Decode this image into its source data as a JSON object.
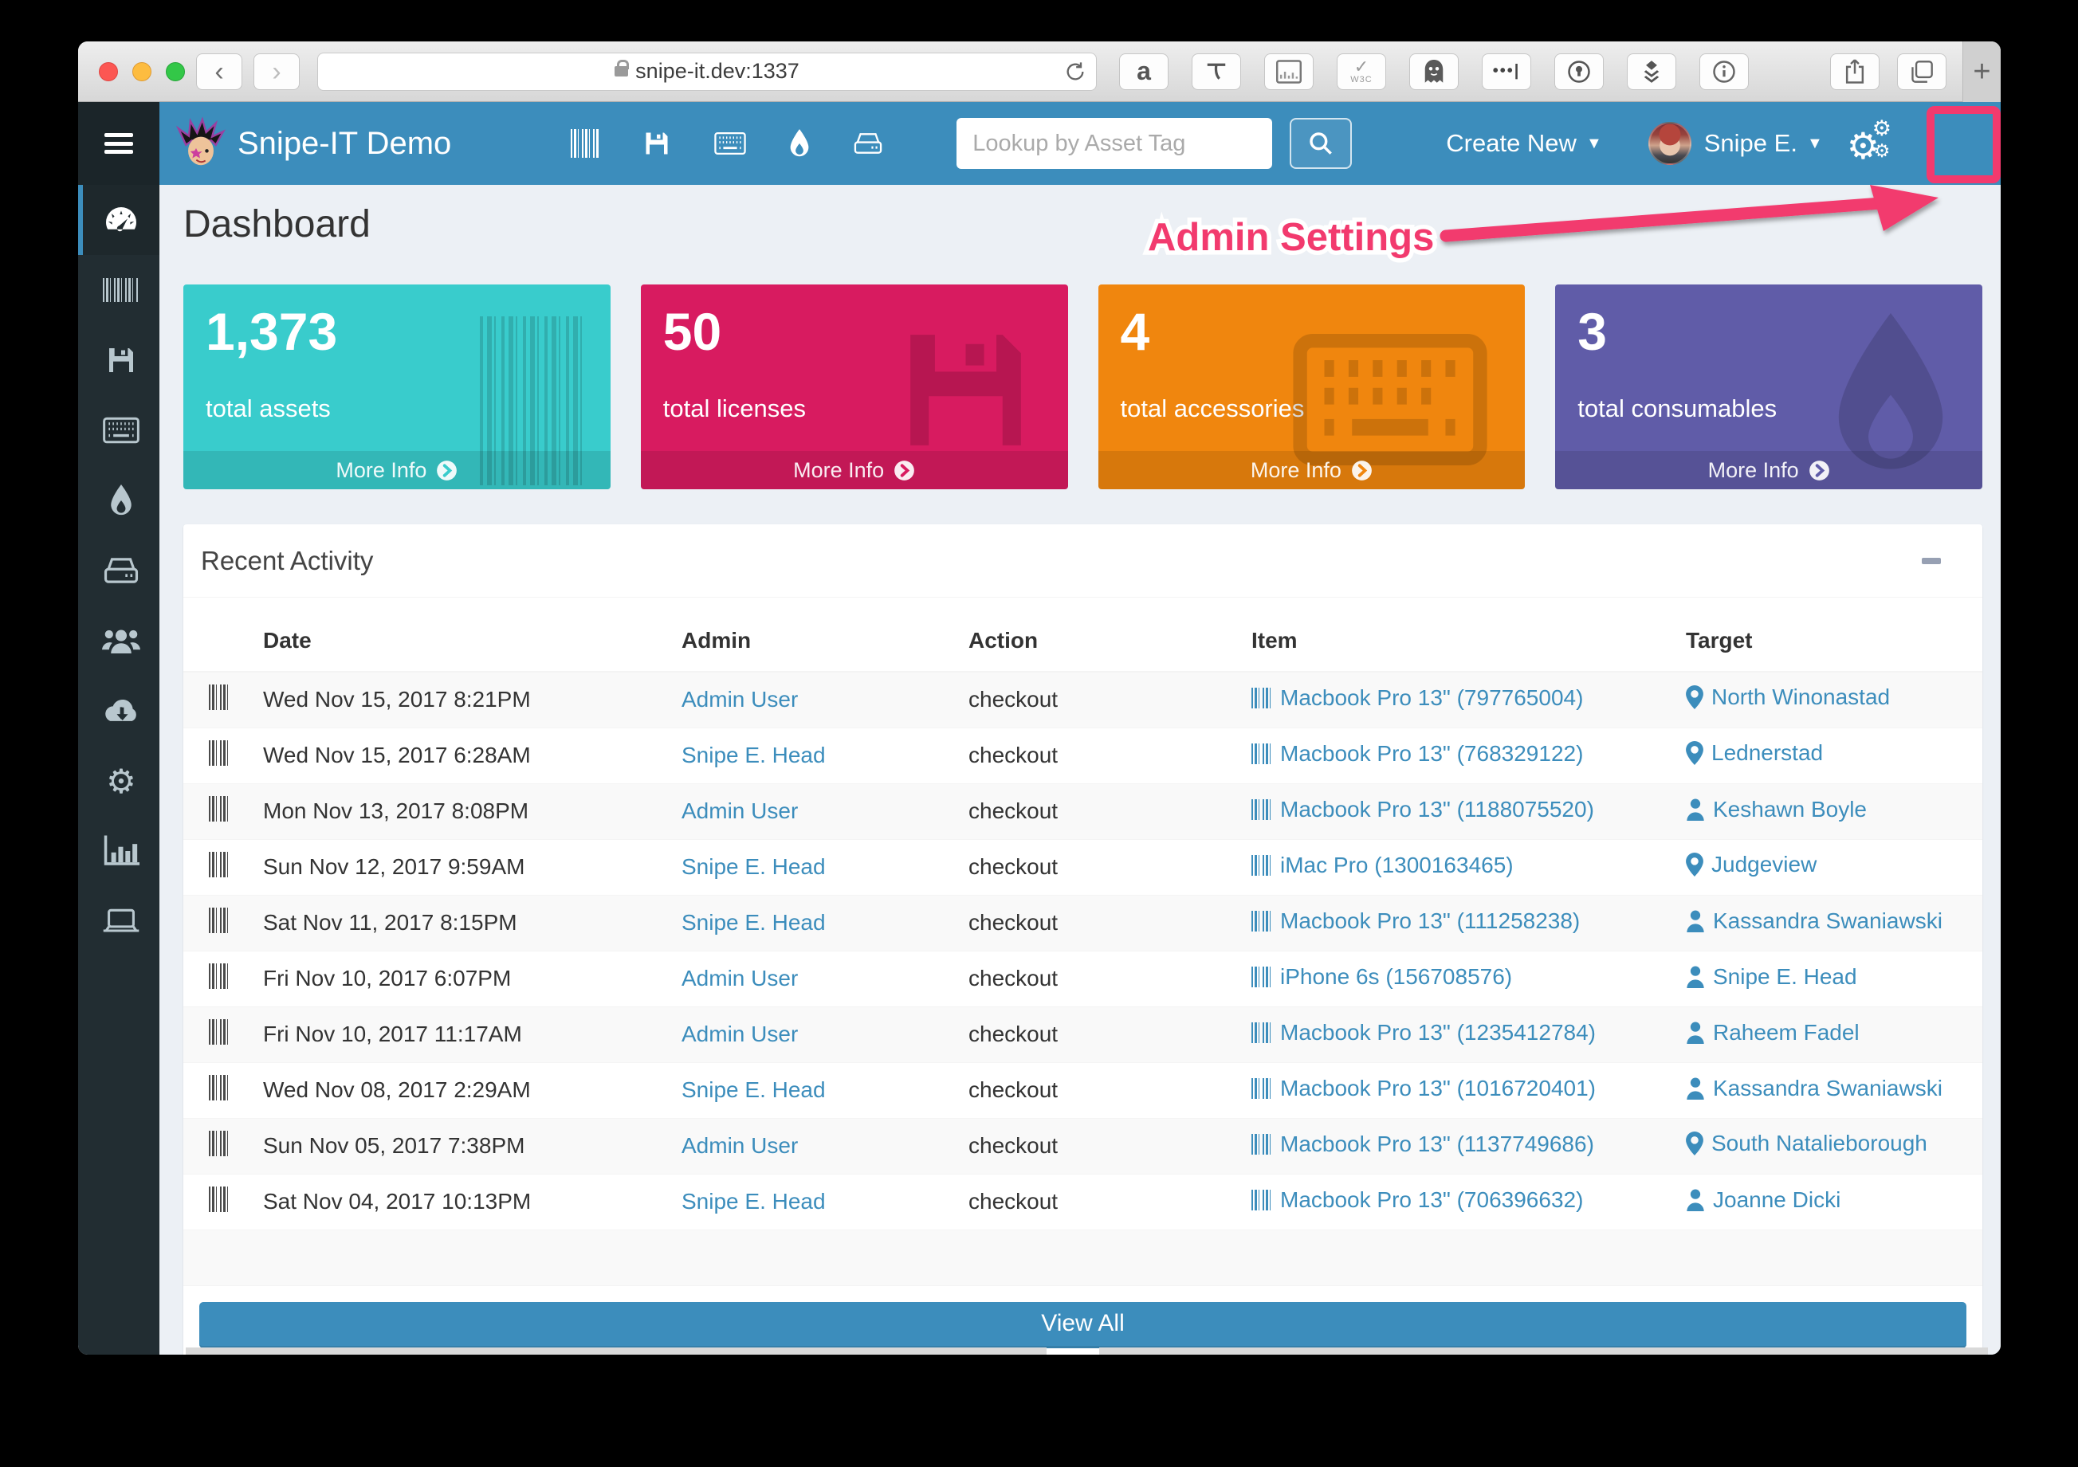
{
  "browser": {
    "url": "snipe-it.dev:1337",
    "new_tab_label": "+",
    "w3c_label": "W3C",
    "amazon_label": "a",
    "more_dots_label": "•••|"
  },
  "navbar": {
    "brand": "Snipe-IT Demo",
    "search_placeholder": "Lookup by Asset Tag",
    "create_new_label": "Create New",
    "user_name": "Snipe E."
  },
  "annotation": {
    "label": "Admin Settings",
    "color": "#f23a6e"
  },
  "page": {
    "title": "Dashboard"
  },
  "stat_boxes": [
    {
      "value": "1,373",
      "label": "total assets",
      "more_label": "More Info",
      "color": "#39cccc",
      "icon": "barcode-icon"
    },
    {
      "value": "50",
      "label": "total licenses",
      "more_label": "More Info",
      "color": "#d81b60",
      "icon": "floppy-icon"
    },
    {
      "value": "4",
      "label": "total accessories",
      "more_label": "More Info",
      "color": "#f0860e",
      "icon": "keyboard-icon"
    },
    {
      "value": "3",
      "label": "total consumables",
      "more_label": "More Info",
      "color": "#605ca8",
      "icon": "droplet-icon"
    }
  ],
  "activity": {
    "title": "Recent Activity",
    "columns": [
      "Date",
      "Admin",
      "Action",
      "Item",
      "Target"
    ],
    "view_all_label": "View All",
    "rows": [
      {
        "date": "Wed Nov 15, 2017 8:21PM",
        "admin": "Admin User",
        "action": "checkout",
        "item": "Macbook Pro 13\" (797765004)",
        "target": "North Winonastad",
        "target_icon": "location-pin-icon"
      },
      {
        "date": "Wed Nov 15, 2017 6:28AM",
        "admin": "Snipe E. Head",
        "action": "checkout",
        "item": "Macbook Pro 13\" (768329122)",
        "target": "Lednerstad",
        "target_icon": "location-pin-icon"
      },
      {
        "date": "Mon Nov 13, 2017 8:08PM",
        "admin": "Admin User",
        "action": "checkout",
        "item": "Macbook Pro 13\" (1188075520)",
        "target": "Keshawn Boyle",
        "target_icon": "user-icon"
      },
      {
        "date": "Sun Nov 12, 2017 9:59AM",
        "admin": "Snipe E. Head",
        "action": "checkout",
        "item": "iMac Pro (1300163465)",
        "target": "Judgeview",
        "target_icon": "location-pin-icon"
      },
      {
        "date": "Sat Nov 11, 2017 8:15PM",
        "admin": "Snipe E. Head",
        "action": "checkout",
        "item": "Macbook Pro 13\" (111258238)",
        "target": "Kassandra Swaniawski",
        "target_icon": "user-icon"
      },
      {
        "date": "Fri Nov 10, 2017 6:07PM",
        "admin": "Admin User",
        "action": "checkout",
        "item": "iPhone 6s (156708576)",
        "target": "Snipe E. Head",
        "target_icon": "user-icon"
      },
      {
        "date": "Fri Nov 10, 2017 11:17AM",
        "admin": "Admin User",
        "action": "checkout",
        "item": "Macbook Pro 13\" (1235412784)",
        "target": "Raheem Fadel",
        "target_icon": "user-icon"
      },
      {
        "date": "Wed Nov 08, 2017 2:29AM",
        "admin": "Snipe E. Head",
        "action": "checkout",
        "item": "Macbook Pro 13\" (1016720401)",
        "target": "Kassandra Swaniawski",
        "target_icon": "user-icon"
      },
      {
        "date": "Sun Nov 05, 2017 7:38PM",
        "admin": "Admin User",
        "action": "checkout",
        "item": "Macbook Pro 13\" (1137749686)",
        "target": "South Natalieborough",
        "target_icon": "location-pin-icon"
      },
      {
        "date": "Sat Nov 04, 2017 10:13PM",
        "admin": "Snipe E. Head",
        "action": "checkout",
        "item": "Macbook Pro 13\" (706396632)",
        "target": "Joanne Dicki",
        "target_icon": "user-icon"
      }
    ]
  },
  "sidebar": {
    "items": [
      "dashboard",
      "assets",
      "licenses",
      "accessories",
      "consumables",
      "components",
      "people",
      "predefined-kits",
      "settings",
      "reports",
      "requestable"
    ]
  }
}
